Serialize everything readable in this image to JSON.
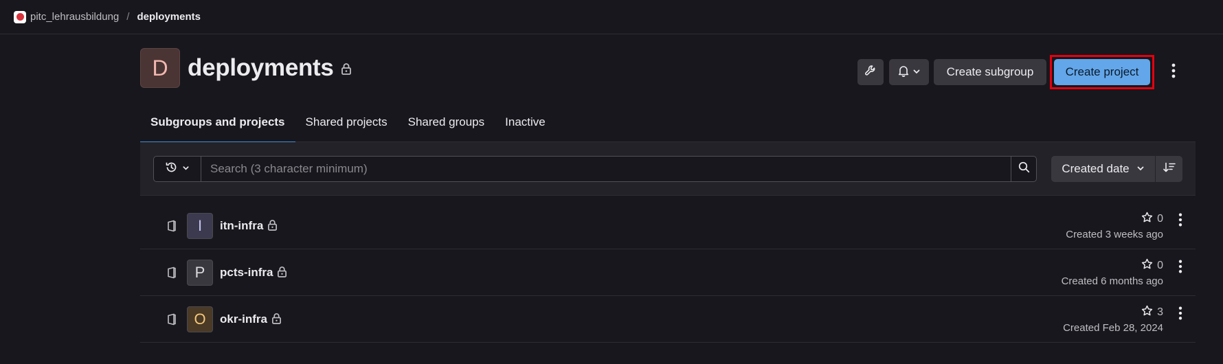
{
  "breadcrumb": {
    "group": "pitc_lehrausbildung",
    "separator": "/",
    "current": "deployments"
  },
  "header": {
    "avatar_letter": "D",
    "title": "deployments",
    "visibility_icon": "lock-icon"
  },
  "actions": {
    "settings_icon": "wrench-icon",
    "notifications_icon": "bell-icon",
    "create_subgroup_label": "Create subgroup",
    "create_project_label": "Create project",
    "more_icon": "vertical-ellipsis-icon"
  },
  "tabs": [
    {
      "label": "Subgroups and projects",
      "active": true
    },
    {
      "label": "Shared projects",
      "active": false
    },
    {
      "label": "Shared groups",
      "active": false
    },
    {
      "label": "Inactive",
      "active": false
    }
  ],
  "filter": {
    "history_icon": "history-icon",
    "search_placeholder": "Search (3 character minimum)",
    "search_value": "",
    "sort_label": "Created date",
    "sort_direction_icon": "sort-lowest-icon"
  },
  "projects": [
    {
      "avatar_letter": "I",
      "name": "itn-infra",
      "stars": "0",
      "created": "Created 3 weeks ago",
      "avatar_bg": "#3b3a4f",
      "avatar_color": "#c4c1ef"
    },
    {
      "avatar_letter": "P",
      "name": "pcts-infra",
      "stars": "0",
      "created": "Created 6 months ago",
      "avatar_bg": "#3a383f",
      "avatar_color": "#dcdcde"
    },
    {
      "avatar_letter": "O",
      "name": "okr-infra",
      "stars": "3",
      "created": "Created Feb 28, 2024",
      "avatar_bg": "#4a3a26",
      "avatar_color": "#f5c779"
    }
  ],
  "colors": {
    "background": "#18171d",
    "primary_button": "#63a6e9",
    "highlight_border": "#e5000f",
    "active_tab_underline": "#418cd8"
  }
}
